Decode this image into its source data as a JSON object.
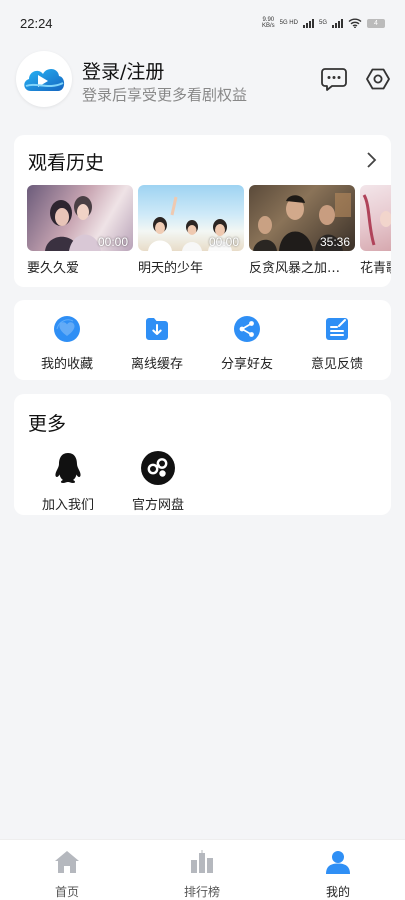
{
  "status_bar": {
    "time": "22:24",
    "net_speed_value": "9.90",
    "net_speed_unit": "KB/s",
    "signal_tag_1": "5G HD",
    "signal_tag_2": "5G",
    "battery": "4"
  },
  "profile": {
    "title": "登录/注册",
    "subtitle": "登录后享受更多看剧权益",
    "icons": [
      "app-logo-icon",
      "message-icon",
      "settings-icon"
    ]
  },
  "history": {
    "title": "观看历史",
    "items": [
      {
        "name": "要久久爱",
        "duration": "00:00"
      },
      {
        "name": "明天的少年",
        "duration": "00:00"
      },
      {
        "name": "反贪风暴之加…",
        "duration": "35:36"
      },
      {
        "name": "花青歌",
        "duration": ""
      }
    ]
  },
  "tools": [
    {
      "label": "我的收藏",
      "icon": "heart-icon"
    },
    {
      "label": "离线缓存",
      "icon": "download-icon"
    },
    {
      "label": "分享好友",
      "icon": "share-icon"
    },
    {
      "label": "意见反馈",
      "icon": "feedback-icon"
    }
  ],
  "more": {
    "title": "更多",
    "items": [
      {
        "label": "加入我们",
        "icon": "qq-penguin-icon"
      },
      {
        "label": "官方网盘",
        "icon": "cloud-drive-icon"
      }
    ]
  },
  "bottom_nav": [
    {
      "label": "首页",
      "icon": "home-icon",
      "active": false
    },
    {
      "label": "排行榜",
      "icon": "ranking-icon",
      "active": false
    },
    {
      "label": "我的",
      "icon": "user-icon",
      "active": true
    }
  ],
  "colors": {
    "accent": "#2f8ff5",
    "background": "#f4f5f7",
    "inactive_icon": "#b5b8be"
  }
}
